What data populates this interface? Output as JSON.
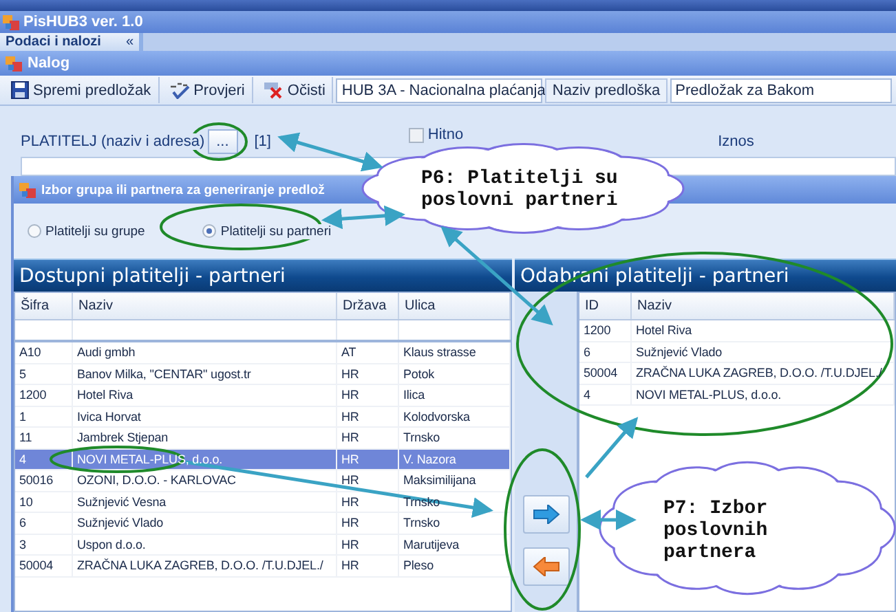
{
  "app_window": {
    "title": "PisHUB3 ver. 1.0",
    "nav_title": "Podaci i nalozi",
    "nav_collapse": "«"
  },
  "order_window": {
    "title": "Nalog",
    "toolbar": [
      {
        "kind": "save",
        "label": "Spremi predložak"
      },
      {
        "kind": "check",
        "label": "Provjeri"
      },
      {
        "kind": "clear",
        "label": "Očisti"
      }
    ],
    "template_type": "HUB 3A - Nacionalna plaćanja",
    "template_name_label": "Naziv predloška",
    "template_name": "Predložak za Bakom",
    "payer_label": "PLATITELJ (naziv i adresa)",
    "payer_browse": "...",
    "payer_count": "[1]",
    "urgent": {
      "label": "Hitno",
      "checked": false
    },
    "amount_label": "Iznos"
  },
  "dialog": {
    "title": "Izbor grupa ili partnera za generiranje predlož",
    "options": [
      {
        "label": "Platitelji su grupe",
        "selected": false
      },
      {
        "label": "Platitelji su partneri",
        "selected": true
      }
    ],
    "available": {
      "title": "Dostupni platitelji - partneri",
      "columns": [
        "Šifra",
        "Naziv",
        "Država",
        "Ulica"
      ],
      "rows": [
        {
          "cells": [
            "A10",
            "Audi gmbh",
            "AT",
            "Klaus strasse"
          ],
          "selected": false
        },
        {
          "cells": [
            "5",
            "Banov Milka, \"CENTAR\" ugost.tr",
            "HR",
            "Potok"
          ],
          "selected": false
        },
        {
          "cells": [
            "1200",
            "Hotel Riva",
            "HR",
            "Ilica"
          ],
          "selected": false
        },
        {
          "cells": [
            "1",
            "Ivica Horvat",
            "HR",
            "Kolodvorska"
          ],
          "selected": false
        },
        {
          "cells": [
            "11",
            "Jambrek Stjepan",
            "HR",
            "Trnsko"
          ],
          "selected": false
        },
        {
          "cells": [
            "4",
            "NOVI METAL-PLUS, d.o.o.",
            "HR",
            "V. Nazora"
          ],
          "selected": true
        },
        {
          "cells": [
            "50016",
            "OZONI, D.O.O. - KARLOVAC",
            "HR",
            "Maksimilijana"
          ],
          "selected": false
        },
        {
          "cells": [
            "10",
            "Sužnjević Vesna",
            "HR",
            "Trnsko"
          ],
          "selected": false
        },
        {
          "cells": [
            "6",
            "Sužnjević Vlado",
            "HR",
            "Trnsko"
          ],
          "selected": false
        },
        {
          "cells": [
            "3",
            "Uspon d.o.o.",
            "HR",
            "Marutijeva"
          ],
          "selected": false
        },
        {
          "cells": [
            "50004",
            "ZRAČNA LUKA ZAGREB, D.O.O. /T.U.DJEL./",
            "HR",
            "Pleso"
          ],
          "selected": false
        }
      ]
    },
    "chosen": {
      "title": "Odabrani platitelji - partneri",
      "columns": [
        "ID",
        "Naziv"
      ],
      "rows": [
        {
          "cells": [
            "1200",
            "Hotel Riva"
          ]
        },
        {
          "cells": [
            "6",
            "Sužnjević Vlado"
          ]
        },
        {
          "cells": [
            "50004",
            "ZRAČNA LUKA ZAGREB, D.O.O. /T.U.DJEL./"
          ]
        },
        {
          "cells": [
            "4",
            "NOVI METAL-PLUS, d.o.o."
          ]
        }
      ]
    },
    "move_buttons": [
      {
        "kind": "add"
      },
      {
        "kind": "remove"
      }
    ]
  },
  "callouts": [
    {
      "text": "P6: Platitelji su poslovni partneri"
    },
    {
      "text": "P7: Izbor poslovnih partnera"
    }
  ]
}
